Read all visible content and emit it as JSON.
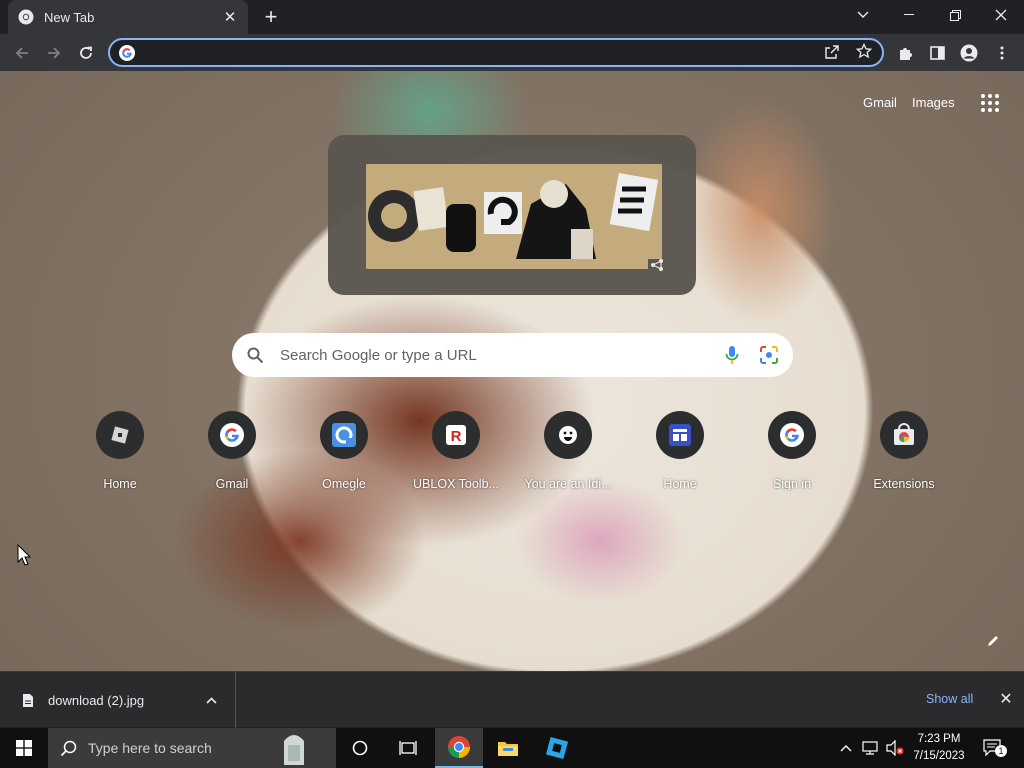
{
  "tab": {
    "title": "New Tab",
    "close": "✕",
    "new_tab": "+"
  },
  "window_controls": {
    "dropdown": "⌄",
    "minimize": "—",
    "restore": "❐",
    "close": "✕"
  },
  "omnibox": {
    "value": "",
    "placeholder": ""
  },
  "ntp": {
    "gmail": "Gmail",
    "images": "Images",
    "search_placeholder": "Search Google or type a URL",
    "shortcuts": [
      {
        "label": "Home",
        "icon": "roblox-icon"
      },
      {
        "label": "Gmail",
        "icon": "google-icon"
      },
      {
        "label": "Omegle",
        "icon": "omegle-icon"
      },
      {
        "label": "UBLOX Toolb...",
        "icon": "roblox-red-icon"
      },
      {
        "label": "You are an Idi...",
        "icon": "smiley-icon"
      },
      {
        "label": "Home",
        "icon": "site-icon"
      },
      {
        "label": "Sign in",
        "icon": "google-icon"
      },
      {
        "label": "Extensions",
        "icon": "chrome-webstore-icon"
      }
    ]
  },
  "download_bar": {
    "file_name": "download (2).jpg",
    "show_all": "Show all",
    "close": "✕"
  },
  "taskbar": {
    "search_placeholder": "Type here to search",
    "time": "7:23 PM",
    "date": "7/15/2023",
    "notifications_count": "1"
  },
  "colors": {
    "accent": "#8ab4f8",
    "toolbar": "#35363a",
    "frame": "#202124",
    "taskbar": "#101010"
  }
}
